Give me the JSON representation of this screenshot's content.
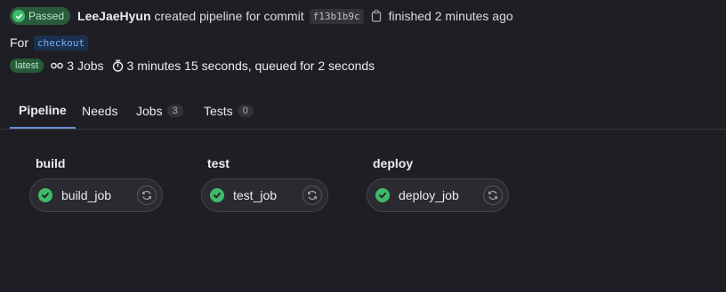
{
  "header": {
    "status": "Passed",
    "author": "LeeJaeHyun",
    "created_text": "created pipeline for commit",
    "commit_sha": "f13b1b9c",
    "finished_text": "finished 2 minutes ago",
    "for_label": "For",
    "ref": "checkout",
    "badge_latest": "latest",
    "jobs_count_text": "3 Jobs",
    "duration_text": "3 minutes 15 seconds, queued for 2 seconds"
  },
  "tabs": [
    {
      "label": "Pipeline",
      "count": ""
    },
    {
      "label": "Needs",
      "count": ""
    },
    {
      "label": "Jobs",
      "count": "3"
    },
    {
      "label": "Tests",
      "count": "0"
    }
  ],
  "stages": [
    {
      "title": "build",
      "job": "build_job"
    },
    {
      "title": "test",
      "job": "test_job"
    },
    {
      "title": "deploy",
      "job": "deploy_job"
    }
  ],
  "colors": {
    "success": "#3fb96a",
    "active_tab_underline": "#6b8fd1",
    "background": "#1f1e24"
  },
  "icons": {
    "status": "check-circle-icon",
    "copy": "copy-icon",
    "jobs": "pipeline-icon",
    "duration": "timer-icon",
    "retry": "retry-icon"
  }
}
